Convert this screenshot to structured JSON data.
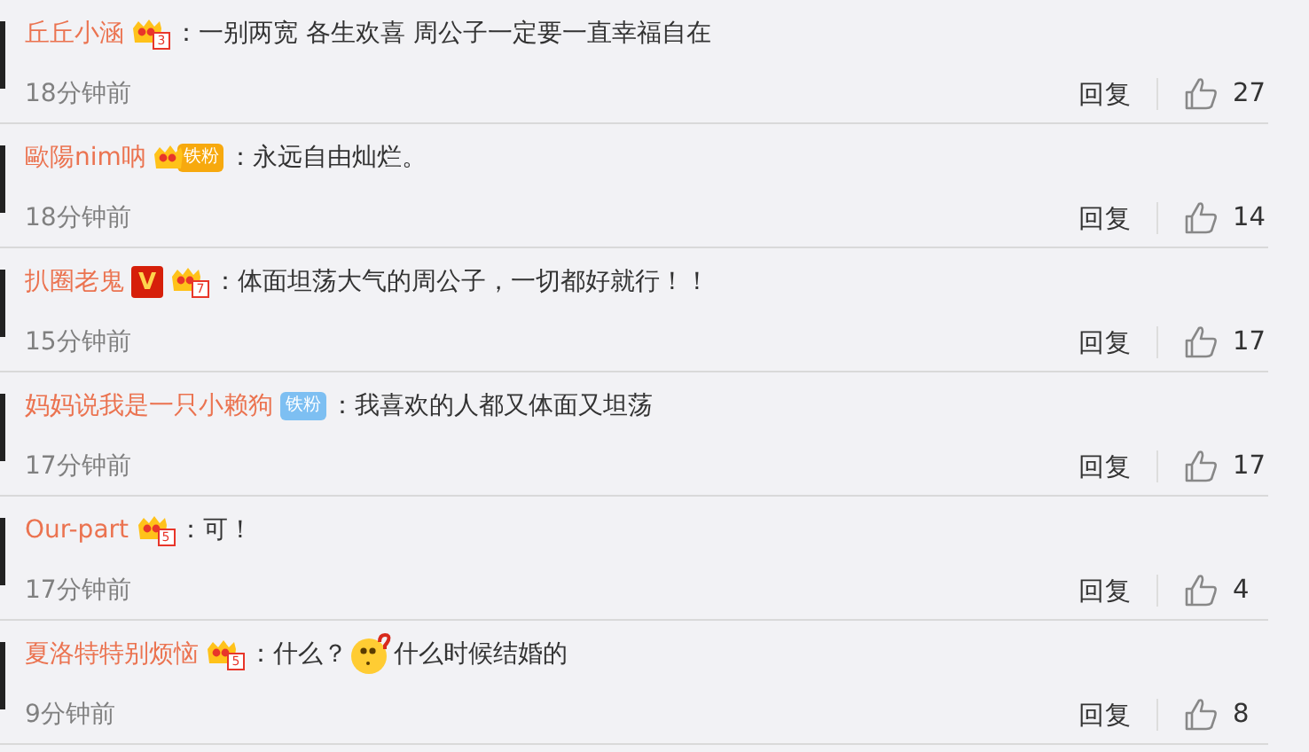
{
  "comments": [
    {
      "author": "丘丘小涵",
      "badges": [
        {
          "kind": "crown",
          "text": "3"
        }
      ],
      "parts": [
        {
          "kind": "text",
          "text": "：一别两宽 各生欢喜 周公子一定要一直幸福自在"
        }
      ],
      "time": "18分钟前",
      "reply": "回复",
      "likes": "27"
    },
    {
      "author": "歐陽nim呐",
      "badges": [
        {
          "kind": "crown-fan",
          "text": "铁粉"
        }
      ],
      "parts": [
        {
          "kind": "text",
          "text": "：永远自由灿烂。"
        }
      ],
      "time": "18分钟前",
      "reply": "回复",
      "likes": "14"
    },
    {
      "author": "扒圈老鬼",
      "badges": [
        {
          "kind": "verified",
          "text": "V"
        },
        {
          "kind": "crown",
          "text": "7"
        }
      ],
      "parts": [
        {
          "kind": "text",
          "text": "：体面坦荡大气的周公子，一切都好就行！！"
        }
      ],
      "time": "15分钟前",
      "reply": "回复",
      "likes": "17"
    },
    {
      "author": "妈妈说我是一只小赖狗",
      "badges": [
        {
          "kind": "fan",
          "text": "铁粉"
        }
      ],
      "parts": [
        {
          "kind": "text",
          "text": "：我喜欢的人都又体面又坦荡"
        }
      ],
      "time": "17分钟前",
      "reply": "回复",
      "likes": "17"
    },
    {
      "author": "Our-part",
      "badges": [
        {
          "kind": "crown",
          "text": "5"
        }
      ],
      "parts": [
        {
          "kind": "text",
          "text": "：可！"
        }
      ],
      "time": "17分钟前",
      "reply": "回复",
      "likes": "4"
    },
    {
      "author": "夏洛特特别烦恼",
      "badges": [
        {
          "kind": "crown",
          "text": "5"
        }
      ],
      "parts": [
        {
          "kind": "text",
          "text": "：什么？"
        },
        {
          "kind": "emoji"
        },
        {
          "kind": "text",
          "text": "什么时候结婚的"
        }
      ],
      "time": "9分钟前",
      "reply": "回复",
      "likes": "8"
    }
  ]
}
